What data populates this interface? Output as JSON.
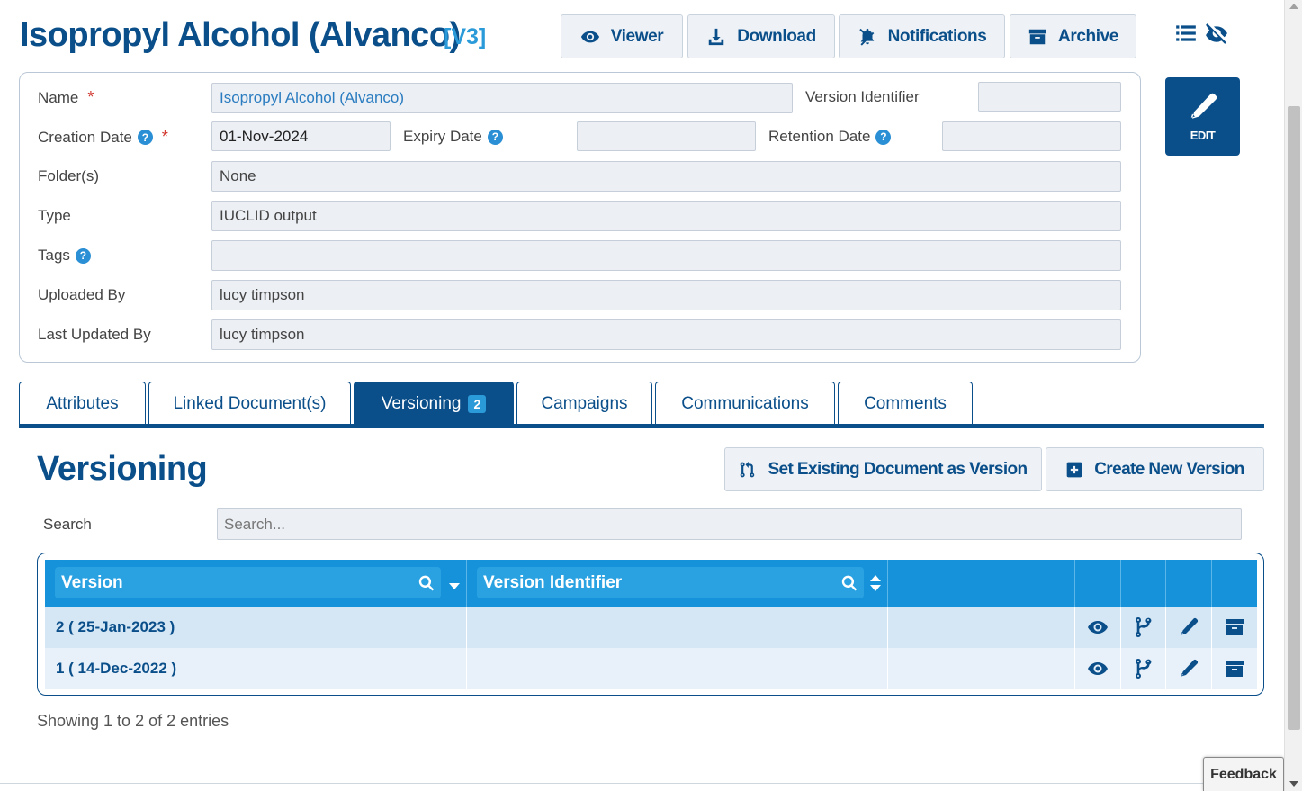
{
  "header": {
    "title": "Isopropyl Alcohol (Alvanco)",
    "version_tag": "[V3]",
    "buttons": {
      "viewer": "Viewer",
      "download": "Download",
      "notifications": "Notifications",
      "archive": "Archive"
    },
    "view_toggle_icons": [
      "list-icon",
      "eye-slash-icon"
    ]
  },
  "form": {
    "name": {
      "label": "Name",
      "required": "*",
      "value": "Isopropyl Alcohol (Alvanco)"
    },
    "version_identifier": {
      "label": "Version Identifier",
      "value": ""
    },
    "creation_date": {
      "label": "Creation Date",
      "required": "*",
      "value": "01-Nov-2024"
    },
    "expiry_date": {
      "label": "Expiry Date",
      "value": ""
    },
    "retention_date": {
      "label": "Retention Date",
      "value": ""
    },
    "folders": {
      "label": "Folder(s)",
      "value": "None"
    },
    "type": {
      "label": "Type",
      "value": "IUCLID output"
    },
    "tags": {
      "label": "Tags",
      "value": ""
    },
    "uploaded_by": {
      "label": "Uploaded By",
      "value": "lucy timpson"
    },
    "last_updated_by": {
      "label": "Last Updated By",
      "value": "lucy timpson"
    },
    "help_glyph": "?",
    "edit_label": "EDIT"
  },
  "tabs": [
    {
      "label": "Attributes"
    },
    {
      "label": "Linked Document(s)"
    },
    {
      "label": "Versioning",
      "badge": "2",
      "active": true
    },
    {
      "label": "Campaigns"
    },
    {
      "label": "Communications"
    },
    {
      "label": "Comments"
    }
  ],
  "versioning": {
    "title": "Versioning",
    "set_existing_label": "Set Existing Document as Version",
    "create_new_label": "Create New Version",
    "search_label": "Search",
    "search_placeholder": "Search...",
    "columns": [
      "Version",
      "Version Identifier"
    ],
    "rows": [
      {
        "version": "2 ( 25-Jan-2023 )",
        "identifier": ""
      },
      {
        "version": "1 ( 14-Dec-2022 )",
        "identifier": ""
      }
    ],
    "showing": "Showing 1 to 2 of 2 entries"
  },
  "feedback_label": "Feedback",
  "colors": {
    "primary": "#0b4f8a",
    "accent": "#2a9ad8",
    "table_header": "#1592d9",
    "required": "#d0342c"
  }
}
